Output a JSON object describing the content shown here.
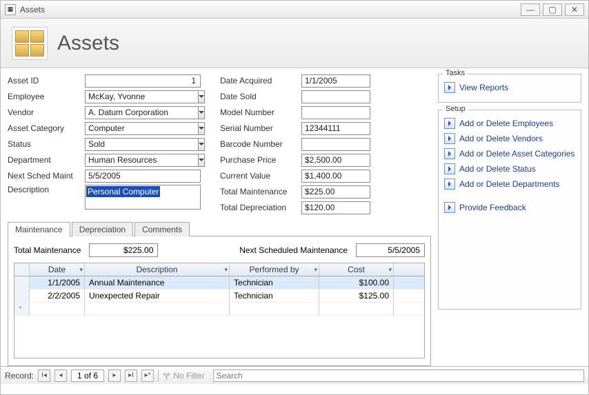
{
  "window": {
    "title": "Assets"
  },
  "header": {
    "title": "Assets"
  },
  "form": {
    "asset_id": {
      "label": "Asset ID",
      "value": "1"
    },
    "employee": {
      "label": "Employee",
      "value": "McKay, Yvonne"
    },
    "vendor": {
      "label": "Vendor",
      "value": "A. Datum Corporation"
    },
    "asset_category": {
      "label": "Asset Category",
      "value": "Computer"
    },
    "status": {
      "label": "Status",
      "value": "Sold"
    },
    "department": {
      "label": "Department",
      "value": "Human Resources"
    },
    "next_sched_maint": {
      "label": "Next Sched Maint",
      "value": "5/5/2005"
    },
    "description": {
      "label": "Description",
      "value": "Personal Computer"
    },
    "date_acquired": {
      "label": "Date Acquired",
      "value": "1/1/2005"
    },
    "date_sold": {
      "label": "Date Sold",
      "value": ""
    },
    "model_number": {
      "label": "Model Number",
      "value": ""
    },
    "serial_number": {
      "label": "Serial Number",
      "value": "12344111"
    },
    "barcode_number": {
      "label": "Barcode Number",
      "value": ""
    },
    "purchase_price": {
      "label": "Purchase Price",
      "value": "$2,500.00"
    },
    "current_value": {
      "label": "Current Value",
      "value": "$1,400.00"
    },
    "total_maintenance": {
      "label": "Total Maintenance",
      "value": "$225.00"
    },
    "total_depreciation": {
      "label": "Total Depreciation",
      "value": "$120.00"
    }
  },
  "tabs": {
    "maintenance": "Maintenance",
    "depreciation": "Depreciation",
    "comments": "Comments"
  },
  "maint": {
    "total_label": "Total Maintenance",
    "total_value": "$225.00",
    "next_label": "Next Scheduled Maintenance",
    "next_value": "5/5/2005",
    "cols": {
      "date": "Date",
      "desc": "Description",
      "perf": "Performed by",
      "cost": "Cost"
    },
    "rows": [
      {
        "date": "1/1/2005",
        "desc": "Annual Maintenance",
        "perf": "Technician",
        "cost": "$100.00"
      },
      {
        "date": "2/2/2005",
        "desc": "Unexpected Repair",
        "perf": "Technician",
        "cost": "$125.00"
      }
    ]
  },
  "tasks": {
    "title": "Tasks",
    "view_reports": "View Reports"
  },
  "setup": {
    "title": "Setup",
    "employees": "Add or Delete Employees",
    "vendors": "Add or Delete Vendors",
    "categories": "Add or Delete Asset Categories",
    "status": "Add or Delete Status",
    "departments": "Add or Delete Departments",
    "feedback": "Provide Feedback"
  },
  "nav": {
    "record_label": "Record:",
    "position": "1 of 6",
    "no_filter": "No Filter",
    "search_placeholder": "Search"
  }
}
